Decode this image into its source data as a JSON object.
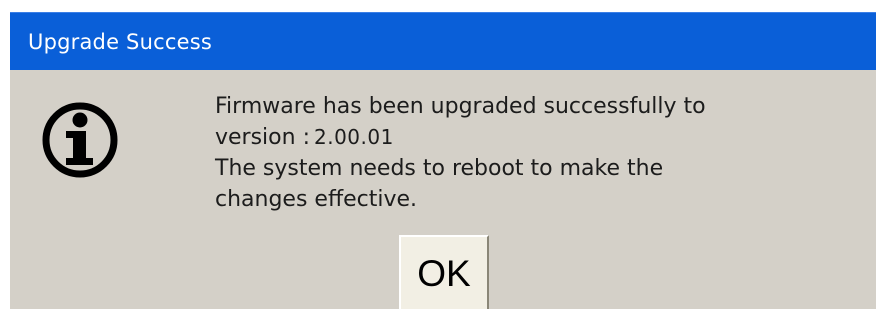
{
  "dialog": {
    "title": "Upgrade Success",
    "icon": "info-circle-icon",
    "message": {
      "line1": "Firmware has been upgraded successfully to",
      "version_label": "version :",
      "version_value": "2.00.01",
      "line3": "The system needs to reboot to make the",
      "line4": "changes effective."
    },
    "ok_label": "OK"
  },
  "colors": {
    "titlebar": "#0a5fd8",
    "dialog_bg": "#d4d0c8",
    "button_bg": "#f2efe4"
  }
}
